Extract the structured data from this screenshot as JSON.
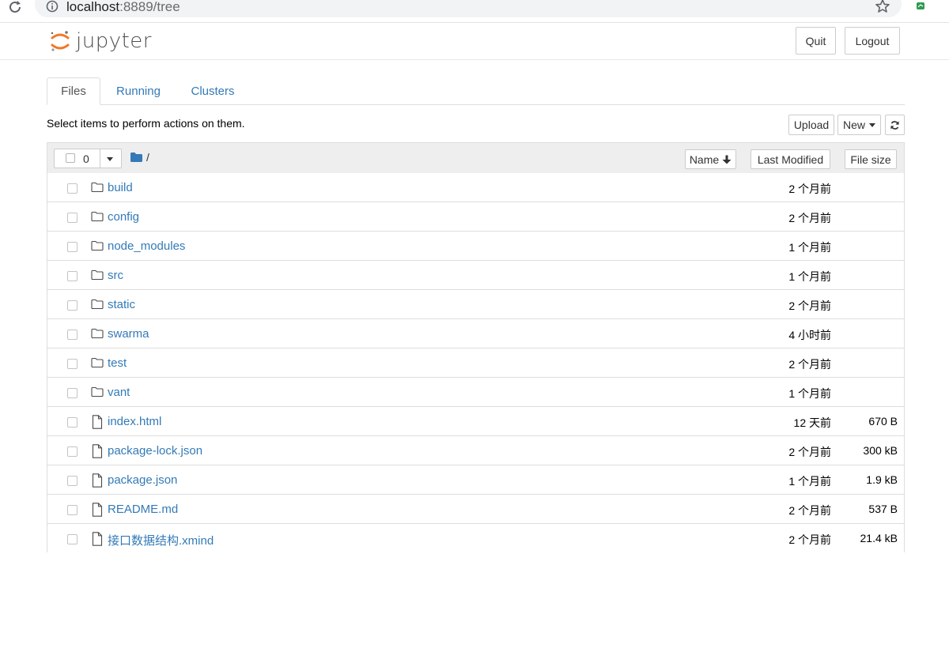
{
  "browser": {
    "url_host": "localhost",
    "url_path": ":8889/tree"
  },
  "header": {
    "logo_text": "jupyter",
    "quit_label": "Quit",
    "logout_label": "Logout"
  },
  "tabs": [
    {
      "label": "Files",
      "active": true
    },
    {
      "label": "Running",
      "active": false
    },
    {
      "label": "Clusters",
      "active": false
    }
  ],
  "toolbar": {
    "hint": "Select items to perform actions on them.",
    "upload_label": "Upload",
    "new_label": "New"
  },
  "list_header": {
    "selected_count": "0",
    "breadcrumb": "/",
    "name_label": "Name",
    "modified_label": "Last Modified",
    "size_label": "File size"
  },
  "files": [
    {
      "name": "build",
      "type": "folder",
      "modified": "2 个月前",
      "size": ""
    },
    {
      "name": "config",
      "type": "folder",
      "modified": "2 个月前",
      "size": ""
    },
    {
      "name": "node_modules",
      "type": "folder",
      "modified": "1 个月前",
      "size": ""
    },
    {
      "name": "src",
      "type": "folder",
      "modified": "1 个月前",
      "size": ""
    },
    {
      "name": "static",
      "type": "folder",
      "modified": "2 个月前",
      "size": ""
    },
    {
      "name": "swarma",
      "type": "folder",
      "modified": "4 小时前",
      "size": ""
    },
    {
      "name": "test",
      "type": "folder",
      "modified": "2 个月前",
      "size": ""
    },
    {
      "name": "vant",
      "type": "folder",
      "modified": "1 个月前",
      "size": ""
    },
    {
      "name": "index.html",
      "type": "file",
      "modified": "12 天前",
      "size": "670 B"
    },
    {
      "name": "package-lock.json",
      "type": "file",
      "modified": "2 个月前",
      "size": "300 kB"
    },
    {
      "name": "package.json",
      "type": "file",
      "modified": "1 个月前",
      "size": "1.9 kB"
    },
    {
      "name": "README.md",
      "type": "file",
      "modified": "2 个月前",
      "size": "537 B"
    },
    {
      "name": "接口数据结构.xmind",
      "type": "file",
      "modified": "2 个月前",
      "size": "21.4 kB"
    }
  ],
  "colors": {
    "link": "#337ab7",
    "logo_orange": "#f37726",
    "header_bg": "#eeeeee"
  }
}
